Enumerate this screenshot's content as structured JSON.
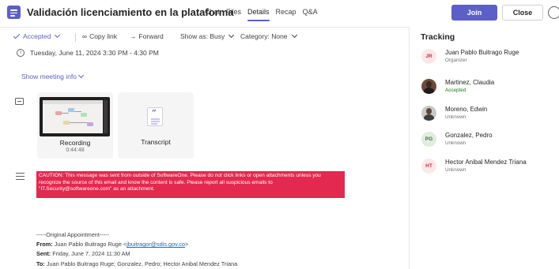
{
  "header": {
    "title": "Validación licenciamiento en la plataforma",
    "tabs": [
      {
        "label": "Chat"
      },
      {
        "label": "Files"
      },
      {
        "label": "Details"
      },
      {
        "label": "Recap"
      },
      {
        "label": "Q&A"
      }
    ],
    "active_tab": "Details",
    "join_label": "Join",
    "close_label": "Close",
    "accent_color": "#5b5fc7"
  },
  "toolbar": {
    "accepted_label": "Accepted",
    "copy_link_label": "Copy link",
    "forward_label": "Forward",
    "show_as_label": "Show as: Busy",
    "category_label": "Category: None"
  },
  "meeting": {
    "datetime": "Tuesday, June 11, 2024 3:30 PM - 4:30 PM",
    "show_info_label": "Show meeting info"
  },
  "attachments": {
    "recording_label": "Recording",
    "recording_duration": "0:44:48",
    "transcript_label": "Transcript"
  },
  "notes": {
    "caution_text": "CAUTION: This message was sent from outside of SoftwareOne. Please do not click links or open attachments unless you recognize the source of this email and know the content is safe. Please report all suspicious emails to \"IT.Security@softwareone.com\" as an attachment.",
    "caution_color": "#e3294f",
    "original_header": "-----Original Appointment-----",
    "from_label": "From:",
    "from_name": "Juan Pablo Buitrago Ruge <",
    "from_email": "jbuitragor@sdis.gov.co",
    "from_end": ">",
    "sent_label": "Sent:",
    "sent_value": "Friday, June 7, 2024 11:30 AM",
    "to_label": "To:",
    "to_value": "Juan Pablo Buitrago Ruge; Gonzalez, Pedro; Hector Anibal Mendez Triana"
  },
  "tracking": {
    "title": "Tracking",
    "people": [
      {
        "initials": "JR",
        "name": "Juan Pablo Buitrago Ruge",
        "status": "Organizer",
        "avatar_bg": "#fde7e9",
        "avatar_fg": "#c4314b"
      },
      {
        "initials": "",
        "name": "Martinez, Claudia",
        "status": "Accepted",
        "avatar_bg": "#6b4a3a",
        "avatar_fg": "#ffffff"
      },
      {
        "initials": "",
        "name": "Moreno, Edwin",
        "status": "Unknown",
        "avatar_bg": "#c9c9c9",
        "avatar_fg": "#ffffff"
      },
      {
        "initials": "PG",
        "name": "Gonzalez, Pedro",
        "status": "Unknown",
        "avatar_bg": "#e0ece0",
        "avatar_fg": "#3b6e3b"
      },
      {
        "initials": "HT",
        "name": "Hector Anibal Mendez Triana",
        "status": "Unknown",
        "avatar_bg": "#fde7e9",
        "avatar_fg": "#c4314b"
      }
    ]
  }
}
